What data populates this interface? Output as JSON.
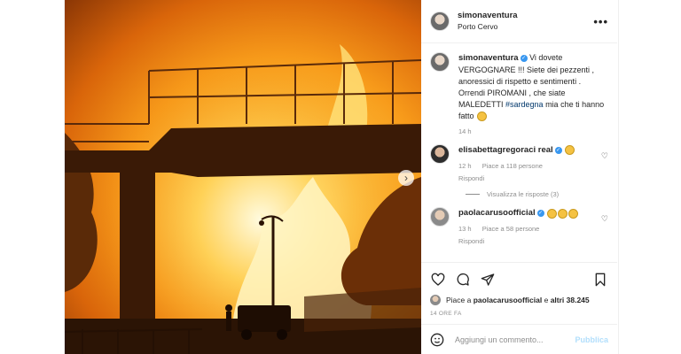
{
  "header": {
    "username": "simonaventura",
    "location": "Porto Cervo",
    "more_label": "•••"
  },
  "caption": {
    "username": "simonaventura",
    "text_before": " Vi dovete VERGOGNARE !!! Siete dei pezzenti , anoressici di rispetto e sentimenti . Orrendi PIROMANI , che siate MALEDETTI ",
    "hashtag": "#sardegna",
    "text_after": " mia che ti hanno fatto",
    "time": "14 h"
  },
  "comments": [
    {
      "username": "elisabettagregoraci real",
      "time": "12 h",
      "likes": "Piace a 118 persone",
      "reply": "Rispondi",
      "view_replies": "Visualizza le risposte (3)"
    },
    {
      "username": "paolacarusoofficial",
      "time": "13 h",
      "likes": "Piace a 58 persone",
      "reply": "Rispondi"
    }
  ],
  "likes_line": {
    "prefix": "Piace a ",
    "user": "paolacarusoofficial",
    "middle": " e ",
    "others": "altri 38.245"
  },
  "time_ago": "14 ORE FA",
  "add_comment": {
    "placeholder": "Aggiungi un commento...",
    "publish_label": "Pubblica"
  },
  "icons": [
    "heart-icon",
    "comment-icon",
    "share-icon",
    "bookmark-icon",
    "emoji-icon",
    "chevron-right-icon"
  ],
  "colors": {
    "verified": "#3897f0",
    "hashtag": "#00376b",
    "muted": "#8e8e8e",
    "publish": "#b2dffc"
  }
}
